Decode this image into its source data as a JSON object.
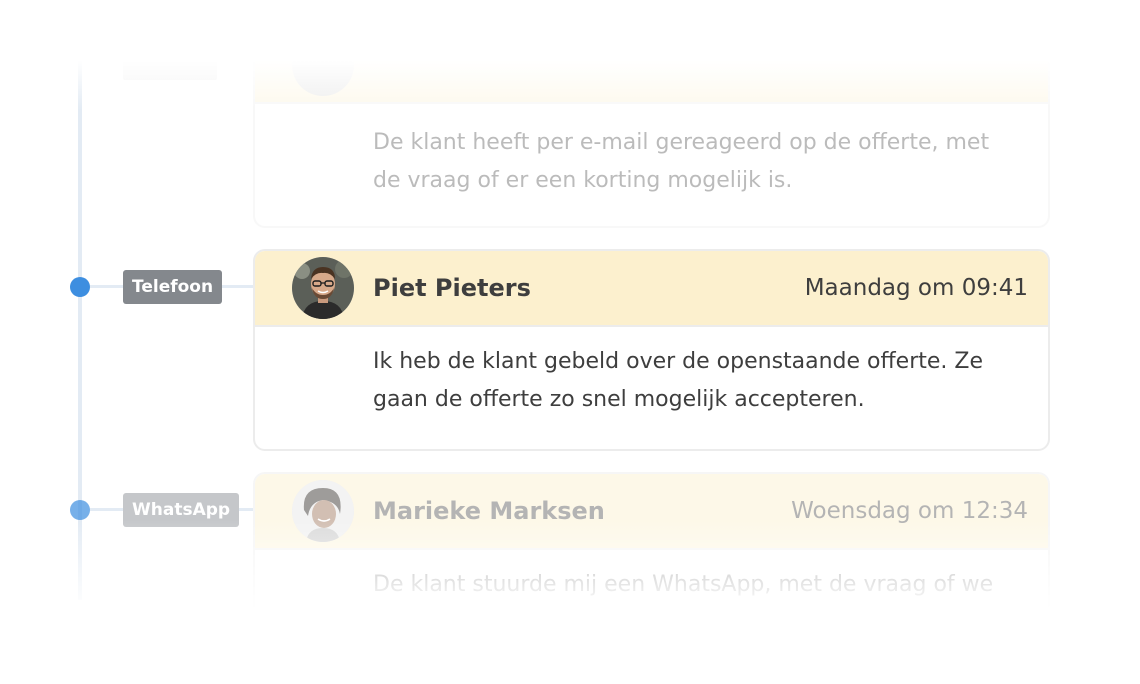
{
  "timeline": {
    "entries": [
      {
        "tag": "",
        "name": "",
        "time": "",
        "message": "De klant heeft per e-mail gereageerd op de offerte, met de vraag of er een korting mogelijk is."
      },
      {
        "tag": "Telefoon",
        "name": "Piet Pieters",
        "time": "Maandag om 09:41",
        "message": "Ik heb de klant gebeld over de openstaande offerte. Ze gaan de offerte zo snel mogelijk accepteren."
      },
      {
        "tag": "WhatsApp",
        "name": "Marieke Marksen",
        "time": "Woensdag om 12:34",
        "message": "De klant stuurde mij een WhatsApp, met de vraag of we"
      }
    ]
  },
  "colors": {
    "accent_dot": "#3d8ee0",
    "header_bg": "#fcf0ce",
    "tag_bg": "#84888d",
    "timeline_line": "#e3ebf4"
  }
}
